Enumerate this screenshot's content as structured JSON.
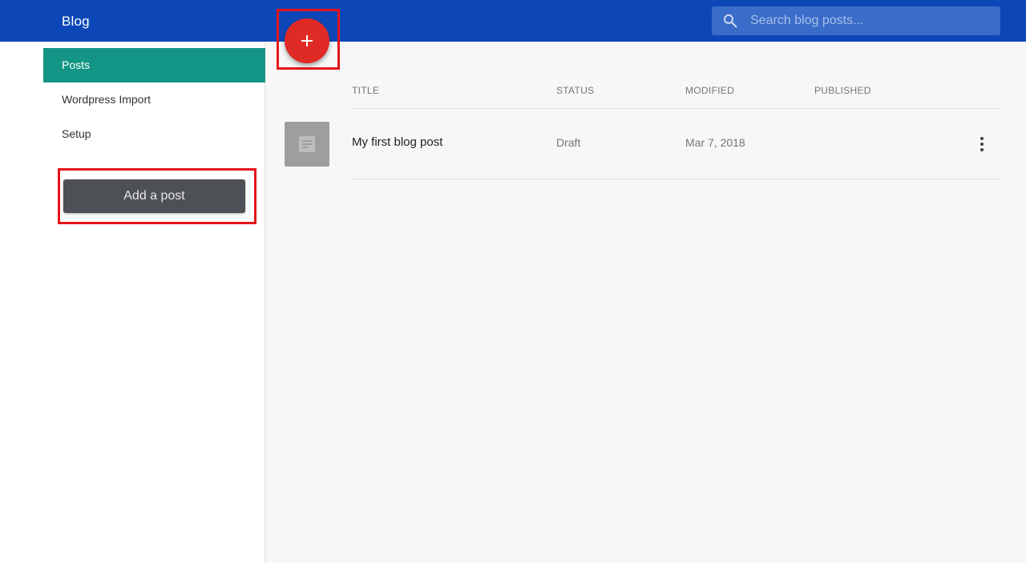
{
  "header": {
    "app_title": "Blog",
    "search_placeholder": "Search blog posts..."
  },
  "sidebar": {
    "items": [
      {
        "label": "Posts",
        "active": true
      },
      {
        "label": "Wordpress Import",
        "active": false
      },
      {
        "label": "Setup",
        "active": false
      }
    ],
    "add_post_label": "Add a post"
  },
  "fab": {
    "icon": "plus-icon",
    "label": "+"
  },
  "table": {
    "columns": [
      "TITLE",
      "STATUS",
      "MODIFIED",
      "PUBLISHED"
    ],
    "rows": [
      {
        "title": "My first blog post",
        "status": "Draft",
        "modified": "Mar 7, 2018",
        "published": ""
      }
    ]
  },
  "colors": {
    "topbar": "#0d47b7",
    "active_nav": "#139585",
    "fab": "#e02a26",
    "annotation_outline": "#e4141b"
  }
}
